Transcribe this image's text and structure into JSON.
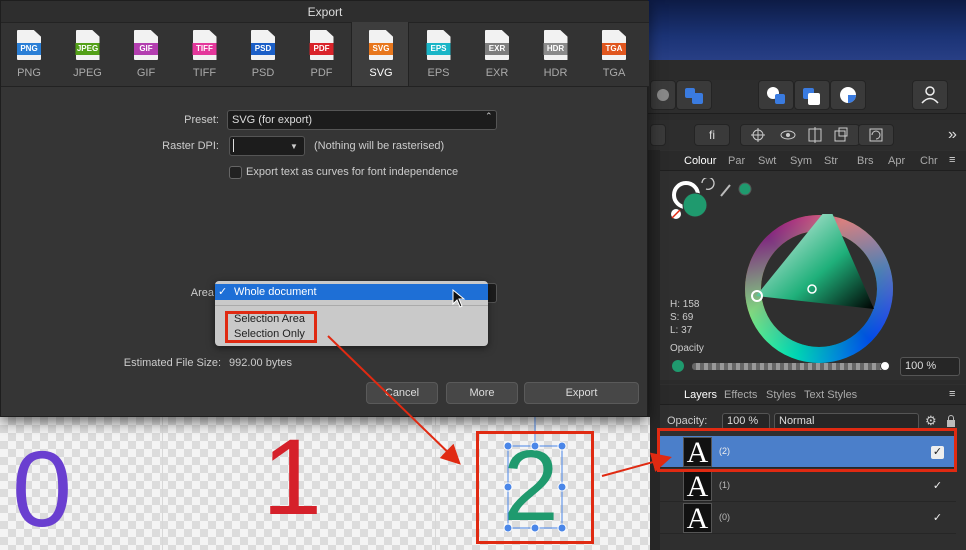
{
  "dialog": {
    "title": "Export",
    "formats": [
      {
        "icon_label": "PNG",
        "label": "PNG",
        "color": "#2b7fd6"
      },
      {
        "icon_label": "JPEG",
        "label": "JPEG",
        "color": "#53a018"
      },
      {
        "icon_label": "GIF",
        "label": "GIF",
        "color": "#b33eb0"
      },
      {
        "icon_label": "TIFF",
        "label": "TIFF",
        "color": "#e4379b"
      },
      {
        "icon_label": "PSD",
        "label": "PSD",
        "color": "#1b5fc7"
      },
      {
        "icon_label": "PDF",
        "label": "PDF",
        "color": "#d9232a"
      },
      {
        "icon_label": "SVG",
        "label": "SVG",
        "color": "#e8771d"
      },
      {
        "icon_label": "EPS",
        "label": "EPS",
        "color": "#1ab5c7"
      },
      {
        "icon_label": "EXR",
        "label": "EXR",
        "color": "#7d7d7d"
      },
      {
        "icon_label": "HDR",
        "label": "HDR",
        "color": "#8a8a8a"
      },
      {
        "icon_label": "TGA",
        "label": "TGA",
        "color": "#e0561e"
      }
    ],
    "selected_format": "SVG",
    "preset_label": "Preset:",
    "preset_value": "SVG (for export)",
    "raster_dpi_label": "Raster DPI:",
    "raster_dpi_value": "",
    "raster_note": "(Nothing will be rasterised)",
    "export_text_checkbox": "Export text as curves for font independence",
    "area_label": "Area",
    "area_options": [
      "Whole document",
      "Selection Area",
      "Selection Only"
    ],
    "area_selected": "Whole document",
    "checkmark": "✓",
    "estimated_label": "Estimated File Size:",
    "estimated_value": "992.00 bytes",
    "cancel": "Cancel",
    "more": "More",
    "export": "Export"
  },
  "canvas": {
    "digits": [
      "0",
      "1",
      "2"
    ],
    "colors": [
      "#6a3fd0",
      "#d5202a",
      "#1f9a6e"
    ]
  },
  "toolbar": {
    "font_button": "fi",
    "more_glyph": "»"
  },
  "colour_panel": {
    "tabs": [
      "Colour",
      "Par",
      "Swt",
      "Sym",
      "Str",
      "Brs",
      "Apr",
      "Chr"
    ],
    "hsl": {
      "h": "H: 158",
      "s": "S: 69",
      "l": "L: 37"
    },
    "opacity_label": "Opacity",
    "opacity_value": "100 %",
    "fill_color": "#1f9a6e"
  },
  "layers_panel": {
    "tabs": [
      "Layers",
      "Effects",
      "Styles",
      "Text Styles"
    ],
    "opacity_label": "Opacity:",
    "opacity_value": "100 %",
    "blend_mode": "Normal",
    "layers": [
      {
        "glyph": "A",
        "name": "(2)",
        "selected": true
      },
      {
        "glyph": "A",
        "name": "(1)",
        "selected": false
      },
      {
        "glyph": "A",
        "name": "(0)",
        "selected": false
      }
    ],
    "check": "✓"
  }
}
